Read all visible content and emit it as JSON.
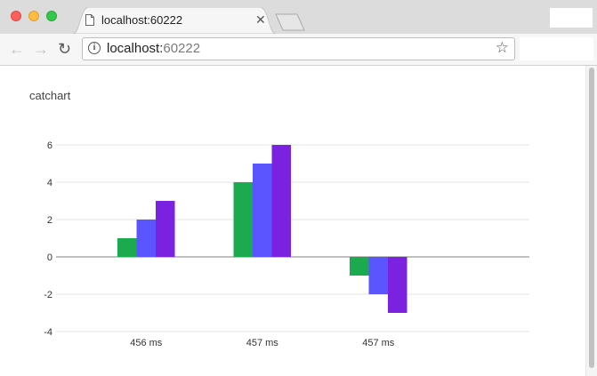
{
  "browser": {
    "tab_title": "localhost:60222",
    "url_host": "localhost:",
    "url_port": "60222",
    "icons": [
      "close-window-icon",
      "minimize-window-icon",
      "zoom-window-icon",
      "page-icon",
      "close-tab-icon",
      "new-tab-icon",
      "back-icon",
      "forward-icon",
      "reload-icon",
      "info-icon",
      "star-icon"
    ]
  },
  "page": {
    "title": "catchart"
  },
  "chart_data": {
    "type": "bar",
    "categories": [
      "456 ms",
      "457 ms",
      "457 ms"
    ],
    "series": [
      {
        "values": [
          1,
          4,
          -1
        ],
        "color": "#1caa4f"
      },
      {
        "values": [
          2,
          5,
          -2
        ],
        "color": "#5a55ff"
      },
      {
        "values": [
          3,
          6,
          -3
        ],
        "color": "#7a22e0"
      }
    ],
    "yticks": [
      6,
      4,
      2,
      0,
      -2,
      -4
    ],
    "ylim": [
      -4,
      6
    ],
    "grid": true
  }
}
